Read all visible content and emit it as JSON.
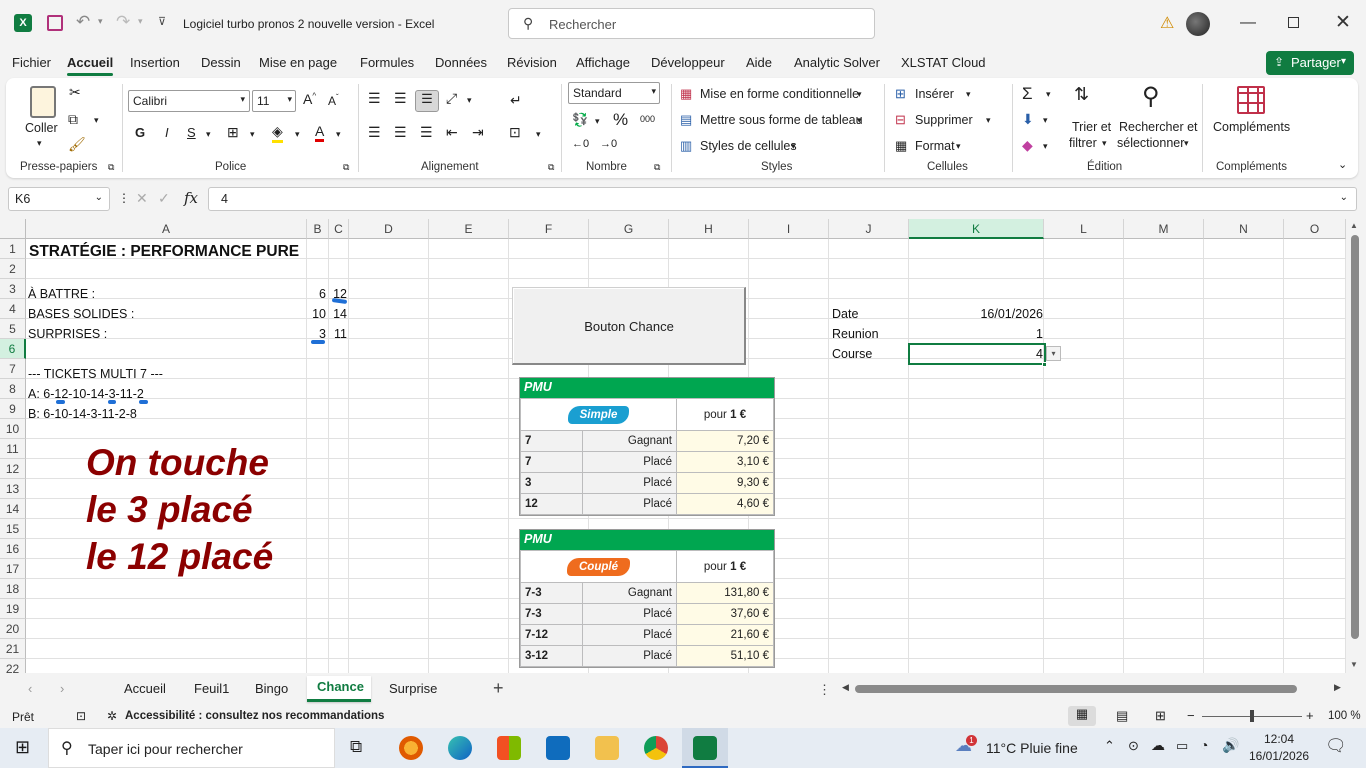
{
  "window": {
    "title": "Logiciel turbo pronos 2 nouvelle version  -  Excel",
    "search_placeholder": "Rechercher"
  },
  "menu": {
    "tabs": [
      "Fichier",
      "Accueil",
      "Insertion",
      "Dessin",
      "Mise en page",
      "Formules",
      "Données",
      "Révision",
      "Affichage",
      "Développeur",
      "Aide",
      "Analytic Solver",
      "XLSTAT Cloud"
    ],
    "share_label": "Partager"
  },
  "ribbon": {
    "clipboard": {
      "paste_label": "Coller",
      "group": "Presse-papiers"
    },
    "font": {
      "family": "Calibri",
      "size": "11",
      "group": "Police",
      "bold": "G",
      "italic": "I",
      "underline": "S"
    },
    "alignment": {
      "group": "Alignement"
    },
    "number": {
      "format": "Standard",
      "group": "Nombre",
      "percent": "%",
      "thousands": "000"
    },
    "styles": {
      "conditional": "Mise en forme conditionnelle",
      "table": "Mettre sous forme de tableau",
      "cell_styles": "Styles de cellules",
      "group": "Styles"
    },
    "cells": {
      "insert": "Insérer",
      "delete": "Supprimer",
      "format": "Format",
      "group": "Cellules"
    },
    "editing": {
      "sort_line1": "Trier et",
      "sort_line2": "filtrer",
      "find_line1": "Rechercher et",
      "find_line2": "sélectionner",
      "group": "Édition"
    },
    "addins": {
      "label": "Compléments",
      "group": "Compléments"
    }
  },
  "formula_bar": {
    "name_box": "K6",
    "fx": "fx",
    "value": "4"
  },
  "columns": [
    "A",
    "B",
    "C",
    "D",
    "E",
    "F",
    "G",
    "H",
    "I",
    "J",
    "K",
    "L",
    "M",
    "N",
    "O"
  ],
  "rows": [
    "1",
    "2",
    "3",
    "4",
    "5",
    "6",
    "7",
    "8",
    "9",
    "10",
    "11",
    "12",
    "13",
    "14",
    "15",
    "16",
    "17",
    "18",
    "19",
    "20",
    "21",
    "22"
  ],
  "sheet": {
    "a1": "STRATÉGIE : PERFORMANCE PURE",
    "a3": "À BATTRE :",
    "b3": "6",
    "c3": "12",
    "a4": "BASES SOLIDES :",
    "b4": "10",
    "c4": "14",
    "a5": "SURPRISES :",
    "b5": "3",
    "c5": "11",
    "a7": "--- TICKETS MULTI 7 ---",
    "a8": "A: 6-12-10-14-3-11-2",
    "a9": "B: 6-10-14-3-11-2-8",
    "j4": "Date",
    "k4": "16/01/2026",
    "j5": "Reunion",
    "k5": "1",
    "j6": "Course",
    "k6": "4",
    "button": "Bouton Chance",
    "note_line1": "On touche",
    "note_line2": "le 3 placé",
    "note_line3": "le 12 placé"
  },
  "pmu_simple": {
    "brand": "PMU",
    "type": "Simple",
    "stake": "pour",
    "stake_value": "1 €",
    "rows": [
      {
        "horse": "7",
        "mode": "Gagnant",
        "payout": "7,20 €"
      },
      {
        "horse": "7",
        "mode": "Placé",
        "payout": "3,10 €"
      },
      {
        "horse": "3",
        "mode": "Placé",
        "payout": "9,30 €"
      },
      {
        "horse": "12",
        "mode": "Placé",
        "payout": "4,60 €"
      }
    ]
  },
  "pmu_couple": {
    "brand": "PMU",
    "type": "Couplé",
    "stake": "pour",
    "stake_value": "1 €",
    "rows": [
      {
        "horse": "7-3",
        "mode": "Gagnant",
        "payout": "131,80 €"
      },
      {
        "horse": "7-3",
        "mode": "Placé",
        "payout": "37,60 €"
      },
      {
        "horse": "7-12",
        "mode": "Placé",
        "payout": "21,60 €"
      },
      {
        "horse": "3-12",
        "mode": "Placé",
        "payout": "51,10 €"
      }
    ]
  },
  "sheet_tabs": [
    "Accueil",
    "Feuil1",
    "Bingo",
    "Chance",
    "Surprise"
  ],
  "active_tab": "Chance",
  "status": {
    "ready": "Prêt",
    "accessibility": "Accessibilité : consultez nos recommandations",
    "zoom": "100 %"
  },
  "taskbar": {
    "search_placeholder": "Taper ici pour rechercher",
    "weather": "11°C  Pluie fine",
    "time": "12:04",
    "date": "16/01/2026",
    "badge": "1"
  },
  "colors": {
    "excel_green": "#107c41",
    "pmu_green": "#00a650",
    "simple_blue": "#1a9fd1",
    "couple_orange": "#ef6c1e",
    "note_red": "#8b0000",
    "pen_blue": "#1f6fd6"
  }
}
